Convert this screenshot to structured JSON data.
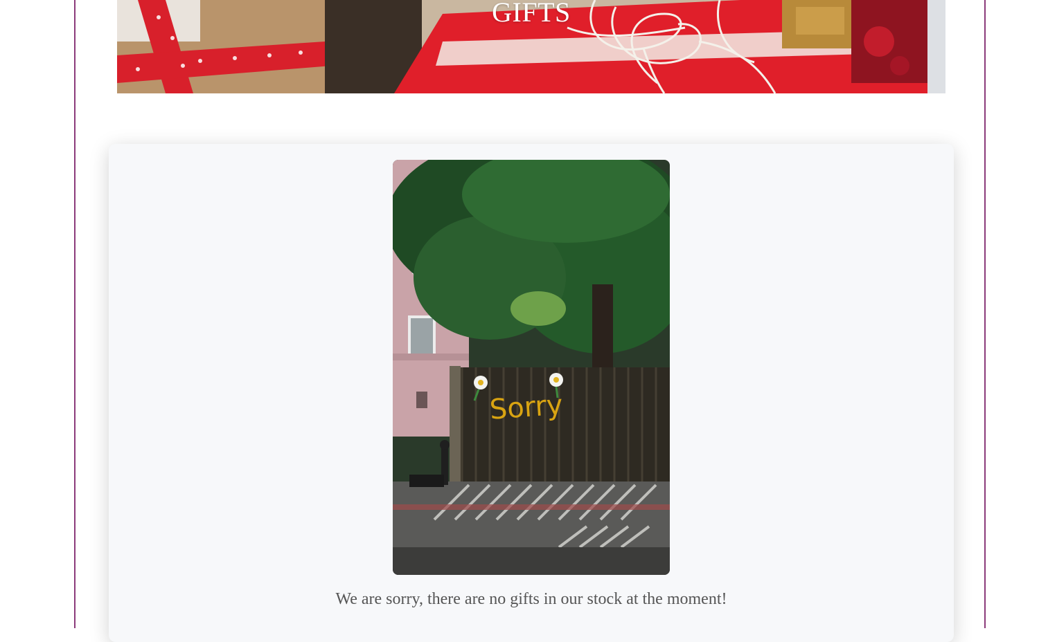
{
  "hero": {
    "title": "GIFTS",
    "image_description_icon": "wrapped-gifts-banner"
  },
  "card": {
    "photo_icon": "sorry-fence-photo",
    "photo_graffiti_text": "Sorry",
    "message": "We are sorry, there are no gifts in our stock at the moment!"
  },
  "colors": {
    "frame_border": "#8b3a7a",
    "card_bg": "#f7f8fa",
    "message_text": "#555555",
    "hero_title": "#ffffff"
  }
}
